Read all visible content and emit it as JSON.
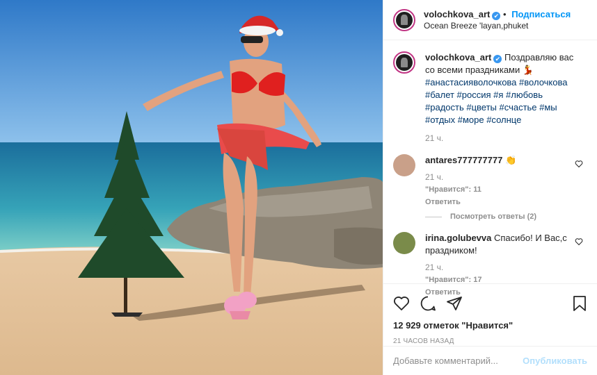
{
  "header": {
    "username": "volochkova_art",
    "verified_glyph": "✔",
    "follow_label": "Подписаться",
    "location": "Ocean Breeze 'layan,phuket"
  },
  "caption": {
    "username": "volochkova_art",
    "text": "Поздравляю вас со всеми праздниками 💃",
    "tags": "#анастасияволочкова #волочкова #балет #россия #я #любовь #радость #цветы #счастье #мы #отдых #море #солнце",
    "time": "21 ч."
  },
  "comments": [
    {
      "username": "antares777777777",
      "text": "👏",
      "time": "21 ч.",
      "likes": "\"Нравится\": 11",
      "reply": "Ответить",
      "view_replies": "Посмотреть ответы (2)",
      "avatar_color": "#c9a089"
    },
    {
      "username": "irina.golubevva",
      "text": "Спасибо! И Вас,с праздником!",
      "time": "21 ч.",
      "likes": "\"Нравится\": 17",
      "reply": "Ответить",
      "avatar_color": "#7a8b4a"
    }
  ],
  "actions": {
    "likes_count": "12 929 отметок \"Нравится\"",
    "posted_ago": "21 ЧАСОВ НАЗАД"
  },
  "add_comment": {
    "placeholder": "Добавьте комментарий...",
    "publish_label": "Опубликовать"
  },
  "colors": {
    "accent": "#0095f6",
    "story_ring": "#c13584",
    "hashtag": "#00376b"
  }
}
